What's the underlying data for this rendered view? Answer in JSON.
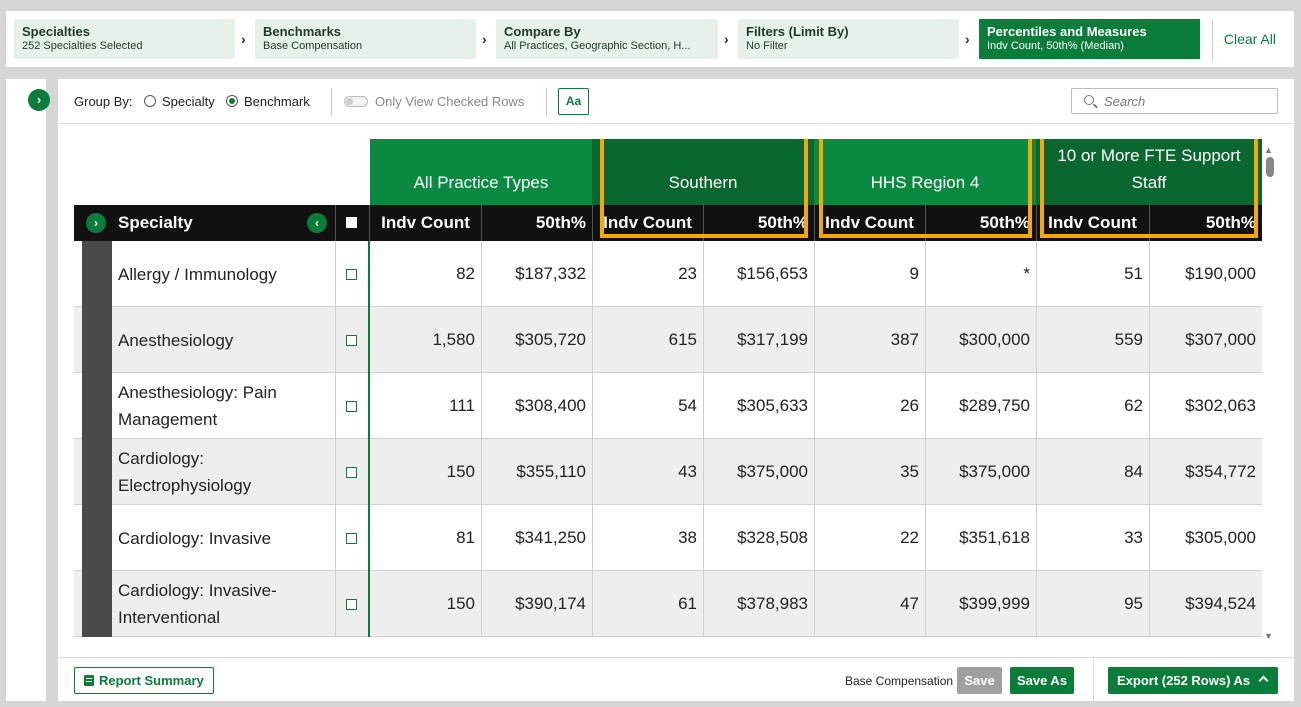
{
  "steps": [
    {
      "title": "Specialties",
      "subtitle": "252 Specialties Selected"
    },
    {
      "title": "Benchmarks",
      "subtitle": "Base Compensation"
    },
    {
      "title": "Compare By",
      "subtitle": "All Practices, Geographic Section, H..."
    },
    {
      "title": "Filters (Limit By)",
      "subtitle": "No Filter"
    },
    {
      "title": "Percentiles and Measures",
      "subtitle": "Indv Count, 50th% (Median)"
    }
  ],
  "clear_all": "Clear All",
  "toolbar": {
    "group_by_label": "Group By:",
    "group_options": [
      "Specialty",
      "Benchmark"
    ],
    "selected_group": "Benchmark",
    "only_checked_label": "Only View Checked Rows",
    "font_button": "Aa",
    "search_placeholder": "Search"
  },
  "table": {
    "column_groups": [
      "All Practice Types",
      "Southern",
      "HHS Region 4",
      "10 or More FTE Support Staff"
    ],
    "specialty_header": "Specialty",
    "count_header": "Indv Count",
    "median_header": "50th%",
    "rows": [
      {
        "name": "Allergy / Immunology",
        "values": [
          "82",
          "$187,332",
          "23",
          "$156,653",
          "9",
          "*",
          "51",
          "$190,000"
        ]
      },
      {
        "name": "Anesthesiology",
        "values": [
          "1,580",
          "$305,720",
          "615",
          "$317,199",
          "387",
          "$300,000",
          "559",
          "$307,000"
        ]
      },
      {
        "name": "Anesthesiology: Pain Management",
        "values": [
          "111",
          "$308,400",
          "54",
          "$305,633",
          "26",
          "$289,750",
          "62",
          "$302,063"
        ]
      },
      {
        "name": "Cardiology: Electrophysiology",
        "values": [
          "150",
          "$355,110",
          "43",
          "$375,000",
          "35",
          "$375,000",
          "84",
          "$354,772"
        ]
      },
      {
        "name": "Cardiology: Invasive",
        "values": [
          "81",
          "$341,250",
          "38",
          "$328,508",
          "22",
          "$351,618",
          "33",
          "$305,000"
        ]
      },
      {
        "name": "Cardiology: Invasive-Interventional",
        "values": [
          "150",
          "$390,174",
          "61",
          "$378,983",
          "47",
          "$399,999",
          "95",
          "$394,524"
        ]
      }
    ]
  },
  "footer": {
    "report_summary": "Report Summary",
    "benchmark_label": "Base Compensation",
    "save": "Save",
    "save_as": "Save As",
    "export": "Export (252 Rows) As"
  },
  "colors": {
    "accent": "#0a7d3b",
    "highlight": "#f5a800",
    "header_dark": "#111111"
  }
}
